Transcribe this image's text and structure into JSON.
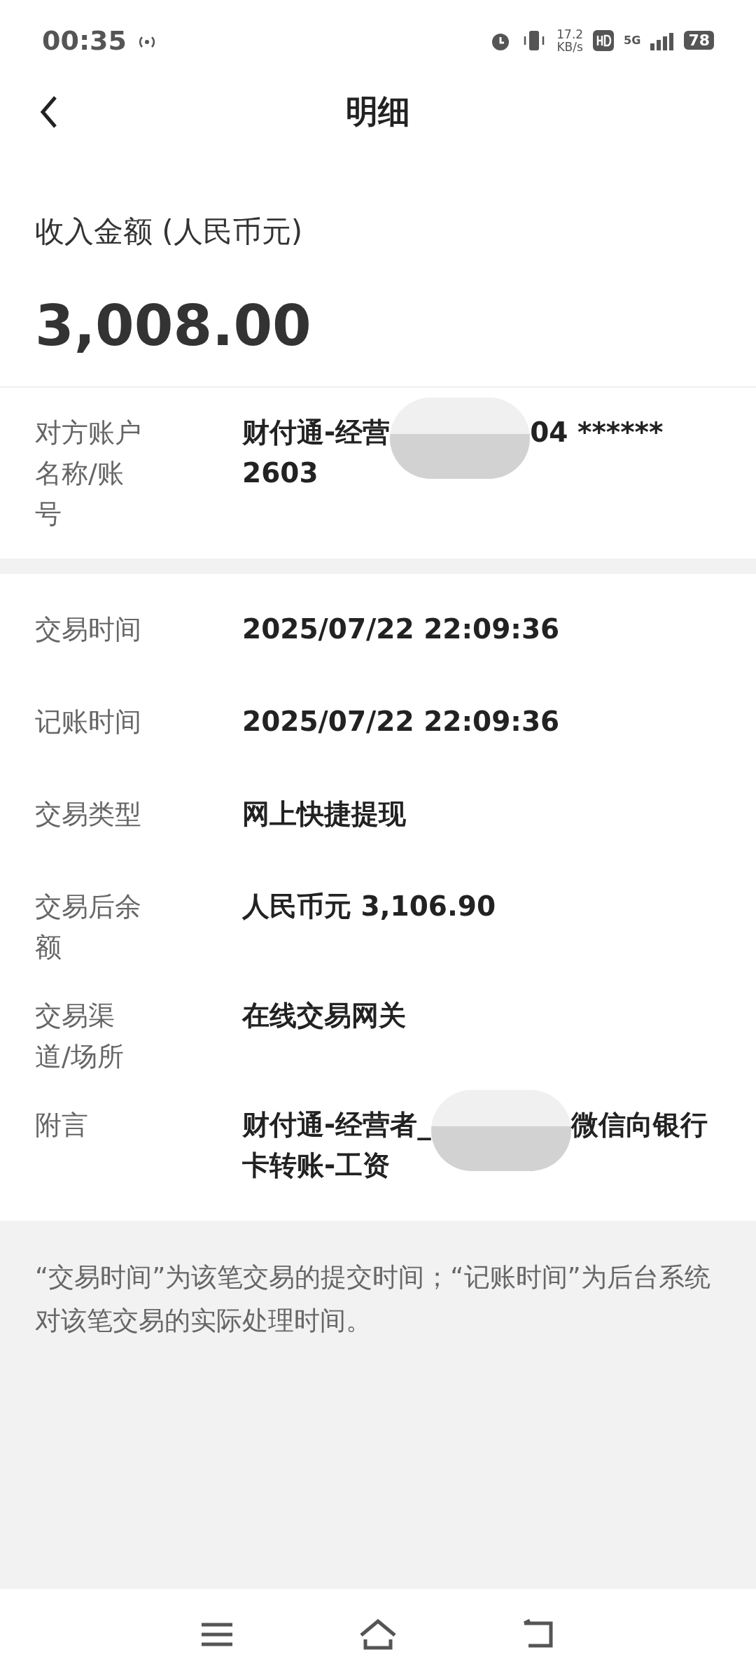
{
  "status_bar": {
    "time": "00:35",
    "speed_value": "17.2",
    "speed_unit": "KB/s",
    "network": "5G",
    "battery": "78"
  },
  "header": {
    "title": "明细"
  },
  "amount": {
    "label": "收入金额 (人民币元)",
    "value": "3,008.00"
  },
  "counterparty": {
    "label": "对方账户名称/账号",
    "value_parts": [
      "财付通-经营",
      "04 ****** 2603"
    ]
  },
  "details": [
    {
      "label": "交易时间",
      "value_parts": [
        "2025/07/22 22:09:36"
      ]
    },
    {
      "label": "记账时间",
      "value_parts": [
        "2025/07/22 22:09:36"
      ]
    },
    {
      "label": "交易类型",
      "value_parts": [
        "网上快捷提现"
      ]
    },
    {
      "label": "交易后余额",
      "value_parts": [
        "人民币元 3,106.90"
      ]
    },
    {
      "label": "交易渠道/场所",
      "value_parts": [
        "在线交易网关"
      ]
    },
    {
      "label": "附言",
      "value_parts": [
        "财付通-经营者_",
        "微信向银行卡转账-工资"
      ]
    }
  ],
  "note": "“交易时间”为该笔交易的提交时间；“记账时间”为后台系统对该笔交易的实际处理时间。"
}
